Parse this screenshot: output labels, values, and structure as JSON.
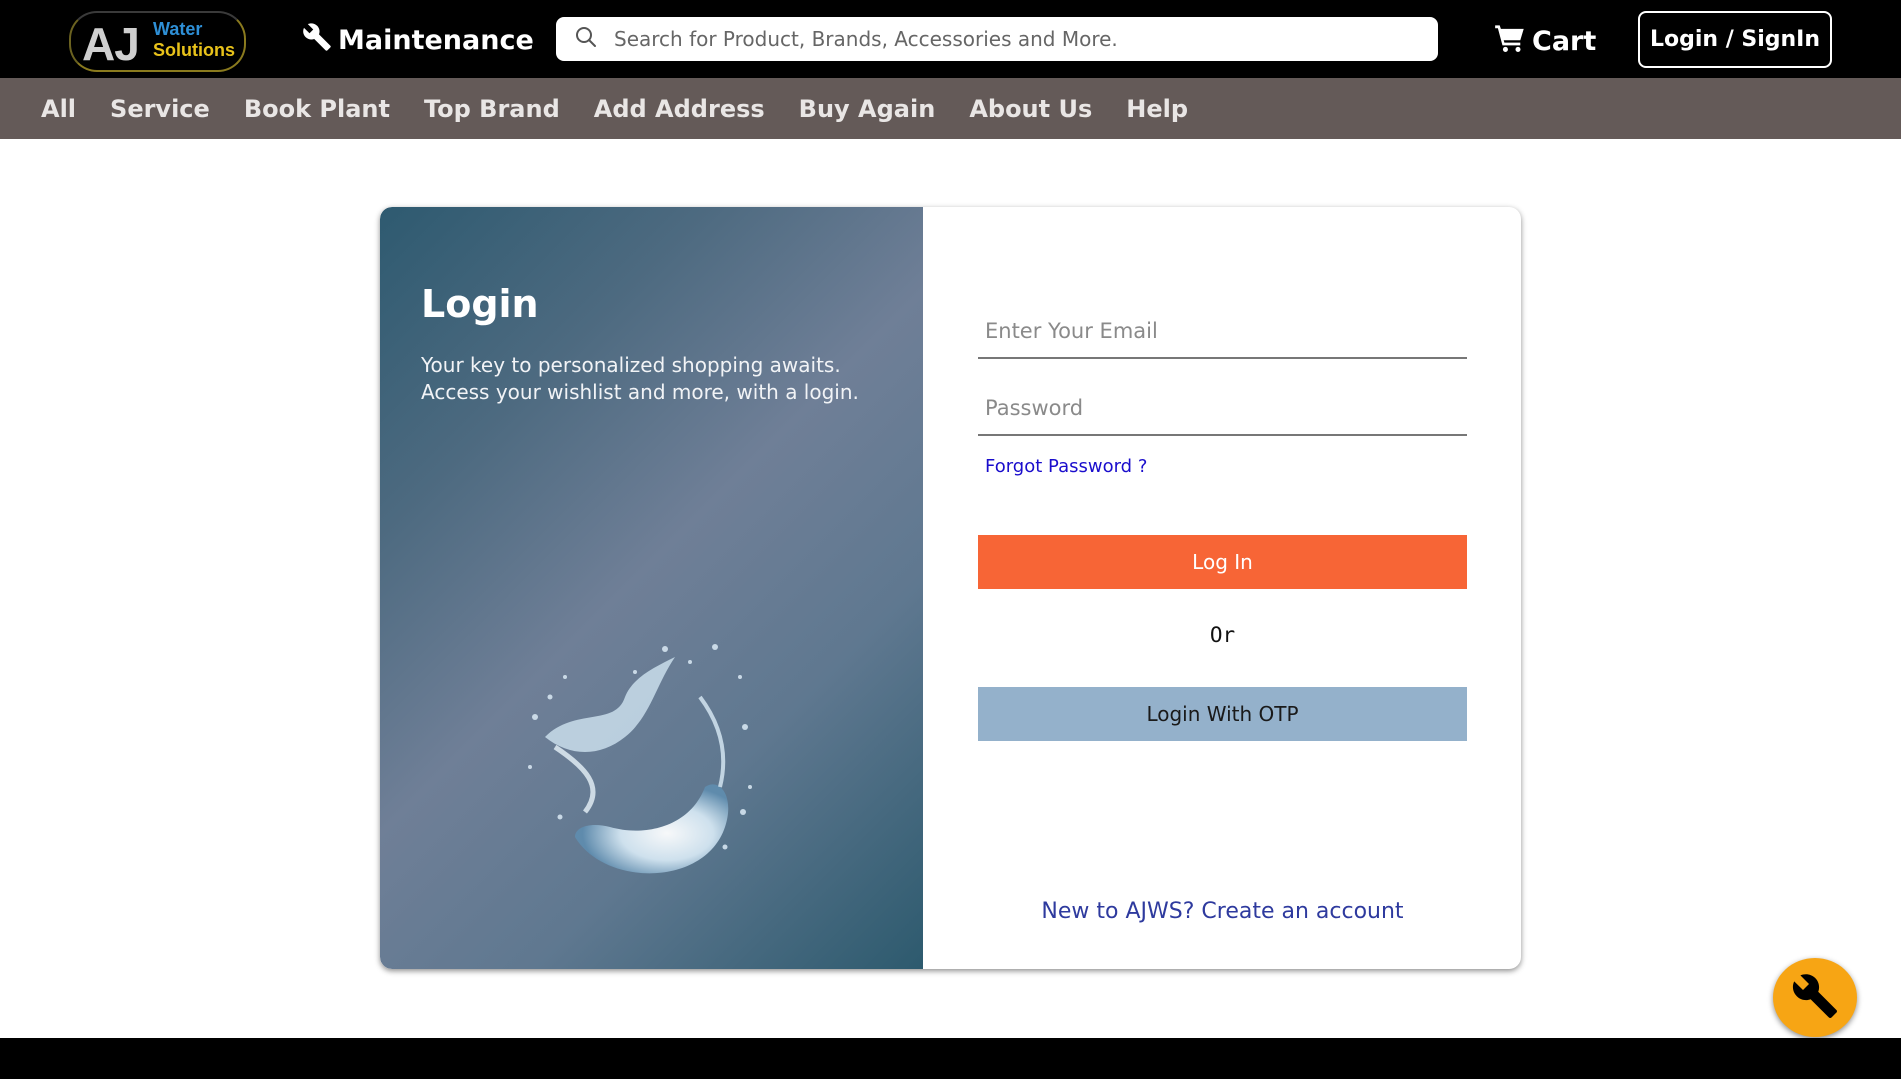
{
  "brand": {
    "initials": "AJ",
    "line1": "Water",
    "line2": "Solutions"
  },
  "header": {
    "maintenance_label": "Maintenance",
    "search_placeholder": "Search for Product, Brands, Accessories and More.",
    "cart_label": "Cart",
    "login_label": "Login / SignIn"
  },
  "nav": {
    "items": [
      {
        "label": "All"
      },
      {
        "label": "Service"
      },
      {
        "label": "Book Plant"
      },
      {
        "label": "Top Brand"
      },
      {
        "label": "Add Address"
      },
      {
        "label": "Buy Again"
      },
      {
        "label": "About Us"
      },
      {
        "label": "Help"
      }
    ]
  },
  "login_card": {
    "title": "Login",
    "subtitle_line1": "Your key to personalized shopping awaits.",
    "subtitle_line2": "Access your wishlist and more, with a login.",
    "email_placeholder": "Enter Your Email",
    "password_placeholder": "Password",
    "forgot_label": "Forgot Password ?",
    "login_button": "Log In",
    "or_label": "Or",
    "otp_button": "Login With OTP",
    "create_account": "New to AJWS? Create an account"
  },
  "icons": {
    "search": "search-icon",
    "wrench": "wrench-icon",
    "cart": "cart-icon",
    "splash": "water-splash-image"
  },
  "colors": {
    "topbar": "#000000",
    "navbar": "#645a58",
    "login_button": "#f76536",
    "otp_button": "#94b1cb",
    "fab": "#f7a514",
    "link": "#1a0dcc"
  }
}
